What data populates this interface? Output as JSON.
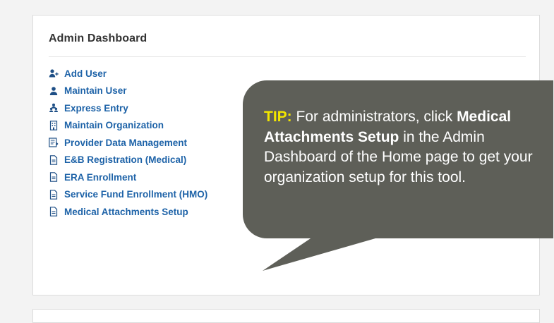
{
  "panel": {
    "title": "Admin Dashboard",
    "items": [
      {
        "label": "Add User",
        "icon": "add-user-icon"
      },
      {
        "label": "Maintain User",
        "icon": "user-icon"
      },
      {
        "label": "Express Entry",
        "icon": "user-group-icon"
      },
      {
        "label": "Maintain Organization",
        "icon": "organization-icon"
      },
      {
        "label": "Provider Data Management",
        "icon": "provider-data-icon"
      },
      {
        "label": "E&B Registration (Medical)",
        "icon": "document-icon"
      },
      {
        "label": "ERA Enrollment",
        "icon": "document-icon"
      },
      {
        "label": "Service Fund Enrollment (HMO)",
        "icon": "document-icon"
      },
      {
        "label": "Medical Attachments Setup",
        "icon": "document-icon"
      }
    ]
  },
  "tip": {
    "label": "TIP:",
    "text1": " For administrators, click ",
    "bold": "Medical Attachments Setup",
    "text2": " in the Admin Dashboard of the Home page to get your organization setup for this tool.",
    "bg_color": "#5e5f58",
    "label_color": "#f2e600"
  },
  "colors": {
    "link": "#1e63a8",
    "page_bg": "#f3f3f3"
  }
}
